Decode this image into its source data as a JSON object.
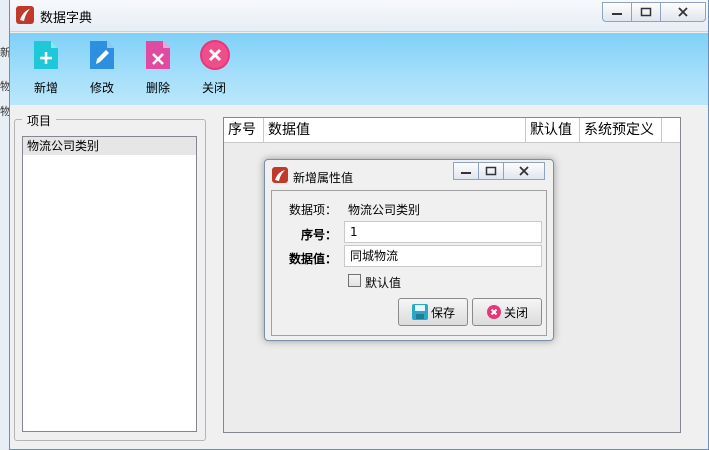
{
  "background": {
    "texts": [
      "新",
      "物",
      "物"
    ]
  },
  "window": {
    "title": "数据字典"
  },
  "toolbar": {
    "add_label": "新增",
    "edit_label": "修改",
    "delete_label": "删除",
    "close_label": "关闭"
  },
  "items_panel": {
    "legend": "项目",
    "items": [
      "物流公司类别"
    ]
  },
  "grid": {
    "columns": [
      "序号",
      "数据值",
      "默认值",
      "系统预定义"
    ]
  },
  "dialog": {
    "title": "新增属性值",
    "data_item_label": "数据项：",
    "data_item_value": "物流公司类别",
    "seq_label": "序号：",
    "seq_value": "1",
    "value_label": "数据值：",
    "value_value": "同城物流",
    "default_label": "默认值",
    "save_label": "保存",
    "close_label": "关闭"
  },
  "colors": {
    "toolbar": "#a6dffa",
    "add_icon": "#1ec8d8",
    "edit_icon": "#2d8fe0",
    "delete_icon": "#e04aa0",
    "close_icon": "#e8367a"
  }
}
